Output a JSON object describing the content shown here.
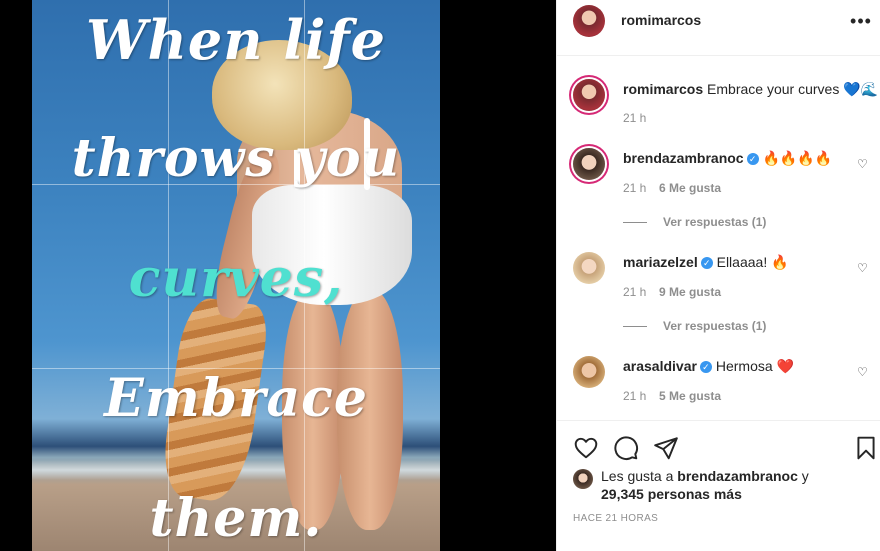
{
  "post": {
    "quote_lines": [
      "When life",
      "throws you",
      "curves,",
      "Embrace",
      "them."
    ],
    "quote_accent_color": "#4fe0d0"
  },
  "header": {
    "username": "romimarcos",
    "more_icon": "ellipsis-icon"
  },
  "caption": {
    "username": "romimarcos",
    "text": "Embrace your curves 💙🌊",
    "time": "21 h"
  },
  "comments": [
    {
      "username": "brendazambranoc",
      "verified": true,
      "text": "🔥🔥🔥🔥",
      "time": "21 h",
      "likes": "6 Me gusta",
      "replies": "Ver respuestas (1)"
    },
    {
      "username": "mariazelzel",
      "verified": true,
      "text": "Ellaaaa! 🔥",
      "time": "21 h",
      "likes": "9 Me gusta",
      "replies": "Ver respuestas (1)"
    },
    {
      "username": "arasaldivar",
      "verified": true,
      "text": "Hermosa ❤️",
      "time": "21 h",
      "likes": "5 Me gusta"
    }
  ],
  "actions": {
    "like_icon": "heart-icon",
    "comment_icon": "comment-icon",
    "share_icon": "paper-plane-icon",
    "save_icon": "bookmark-icon"
  },
  "likes": {
    "prefix": "Les gusta a ",
    "user": "brendazambranoc",
    "and": " y",
    "others": "29,345 personas más"
  },
  "timestamp": "HACE 21 HORAS",
  "colors": {
    "verified": "#3897f0",
    "muted": "#8e8e8e",
    "text": "#262626"
  }
}
